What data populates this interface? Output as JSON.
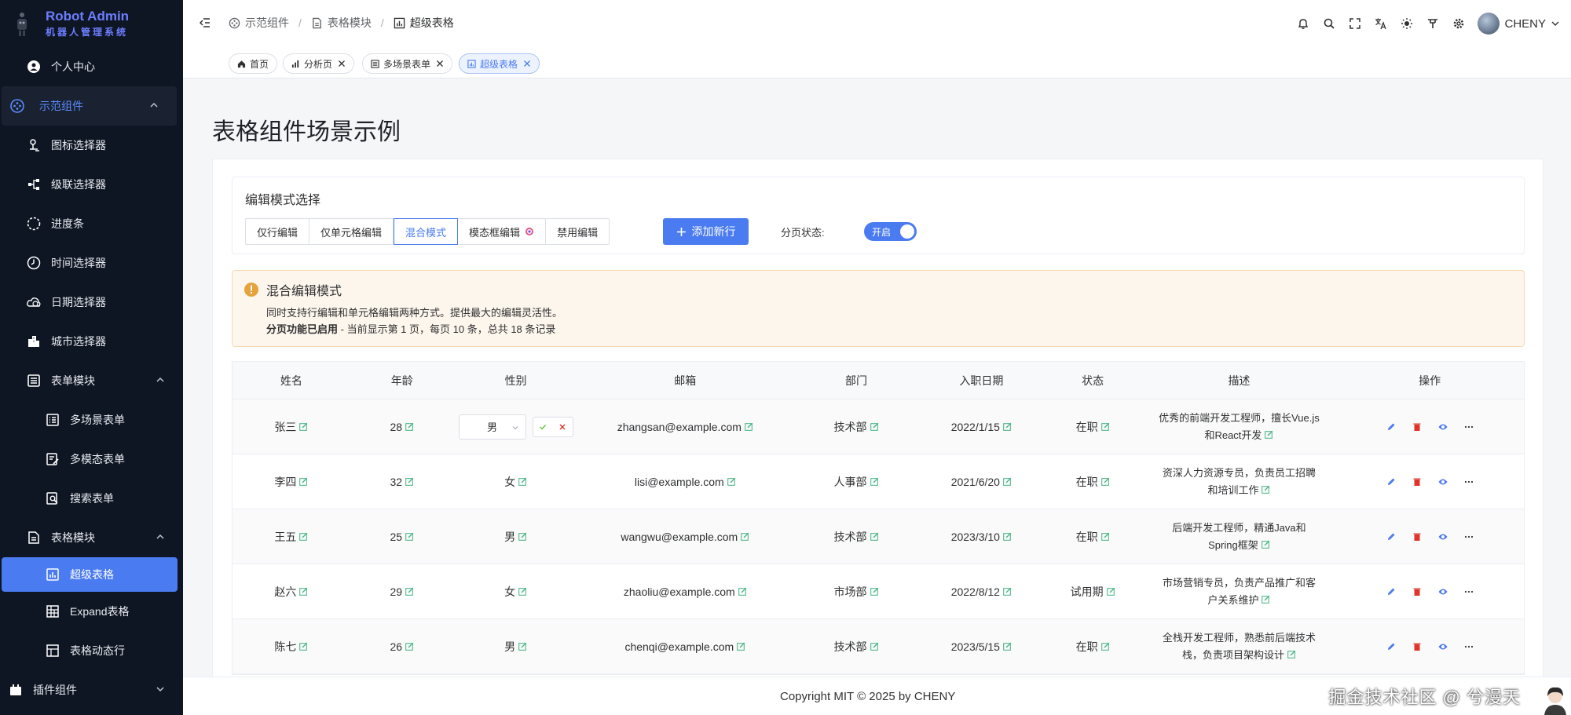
{
  "brand": {
    "title": "Robot Admin",
    "subtitle": "机器人管理系统"
  },
  "sidebar": {
    "items": [
      {
        "label": "个人中心",
        "icon": "user-circle-icon"
      },
      {
        "label": "示范组件",
        "icon": "gamepad-icon"
      },
      {
        "label": "图标选择器",
        "icon": "pin-icon"
      },
      {
        "label": "级联选择器",
        "icon": "cascade-icon"
      },
      {
        "label": "进度条",
        "icon": "dashed-circle-icon"
      },
      {
        "label": "时间选择器",
        "icon": "clock-icon"
      },
      {
        "label": "日期选择器",
        "icon": "cloud-clock-icon"
      },
      {
        "label": "城市选择器",
        "icon": "buildings-icon"
      },
      {
        "label": "表单模块",
        "icon": "form-icon"
      },
      {
        "label": "多场景表单",
        "icon": "list-icon"
      },
      {
        "label": "多模态表单",
        "icon": "form-edit-icon"
      },
      {
        "label": "搜索表单",
        "icon": "search-doc-icon"
      },
      {
        "label": "表格模块",
        "icon": "doc-icon"
      },
      {
        "label": "超级表格",
        "icon": "table-chart-icon"
      },
      {
        "label": "Expand表格",
        "icon": "grid-icon"
      },
      {
        "label": "表格动态行",
        "icon": "table-icon"
      },
      {
        "label": "插件组件",
        "icon": "plugin-icon"
      }
    ]
  },
  "header": {
    "breadcrumb": [
      "示范组件",
      "表格模块",
      "超级表格"
    ],
    "separator": "/",
    "username": "CHENY"
  },
  "tabs": [
    {
      "label": "首页",
      "icon": "home-icon",
      "closable": false
    },
    {
      "label": "分析页",
      "icon": "bar-chart-icon",
      "closable": true
    },
    {
      "label": "多场景表单",
      "icon": "list-icon",
      "closable": true
    },
    {
      "label": "超级表格",
      "icon": "table-chart-icon",
      "closable": true,
      "active": true
    }
  ],
  "page": {
    "title": "表格组件场景示例"
  },
  "mode": {
    "title": "编辑模式选择",
    "options": [
      "仅行编辑",
      "仅单元格编辑",
      "混合模式",
      "模态框编辑",
      "禁用编辑"
    ],
    "selected": "混合模式",
    "add_label": "添加新行",
    "pagination_label": "分页状态:",
    "pagination_switch": "开启"
  },
  "alert": {
    "title": "混合编辑模式",
    "desc": "同时支持行编辑和单元格编辑两种方式。提供最大的编辑灵活性。",
    "line2_bold": "分页功能已启用",
    "line2_text": " - 当前显示第 1 页，每页 10 条，总共 18 条记录"
  },
  "table": {
    "columns": [
      "姓名",
      "年龄",
      "性别",
      "邮箱",
      "部门",
      "入职日期",
      "状态",
      "描述",
      "操作"
    ],
    "rows": [
      {
        "name": "张三",
        "age": "28",
        "gender": "男",
        "email": "zhangsan@example.com",
        "dept": "技术部",
        "date": "2022/1/15",
        "status": "在职",
        "desc1": "优秀的前端开发工程师，擅长Vue.js",
        "desc2": "和React开发",
        "editing_gender": true
      },
      {
        "name": "李四",
        "age": "32",
        "gender": "女",
        "email": "lisi@example.com",
        "dept": "人事部",
        "date": "2021/6/20",
        "status": "在职",
        "desc1": "资深人力资源专员，负责员工招聘",
        "desc2": "和培训工作"
      },
      {
        "name": "王五",
        "age": "25",
        "gender": "男",
        "email": "wangwu@example.com",
        "dept": "技术部",
        "date": "2023/3/10",
        "status": "在职",
        "desc1": "后端开发工程师，精通Java和",
        "desc2": "Spring框架"
      },
      {
        "name": "赵六",
        "age": "29",
        "gender": "女",
        "email": "zhaoliu@example.com",
        "dept": "市场部",
        "date": "2022/8/12",
        "status": "试用期",
        "desc1": "市场营销专员，负责产品推广和客",
        "desc2": "户关系维护"
      },
      {
        "name": "陈七",
        "age": "26",
        "gender": "男",
        "email": "chenqi@example.com",
        "dept": "技术部",
        "date": "2023/5/15",
        "status": "在职",
        "desc1": "全栈开发工程师，熟悉前后端技术",
        "desc2": "栈，负责项目架构设计"
      }
    ]
  },
  "footer": {
    "copyright": "Copyright MIT © 2025 by CHENY",
    "watermark": "掘金技术社区 @ 兮漫天"
  },
  "colors": {
    "primary": "#4a7bf0",
    "sidebar_bg": "#0f1623",
    "brand": "#6d7dff",
    "edit_icon": "#3fb37f",
    "warning": "#e6a23c",
    "danger": "#e0342a"
  }
}
